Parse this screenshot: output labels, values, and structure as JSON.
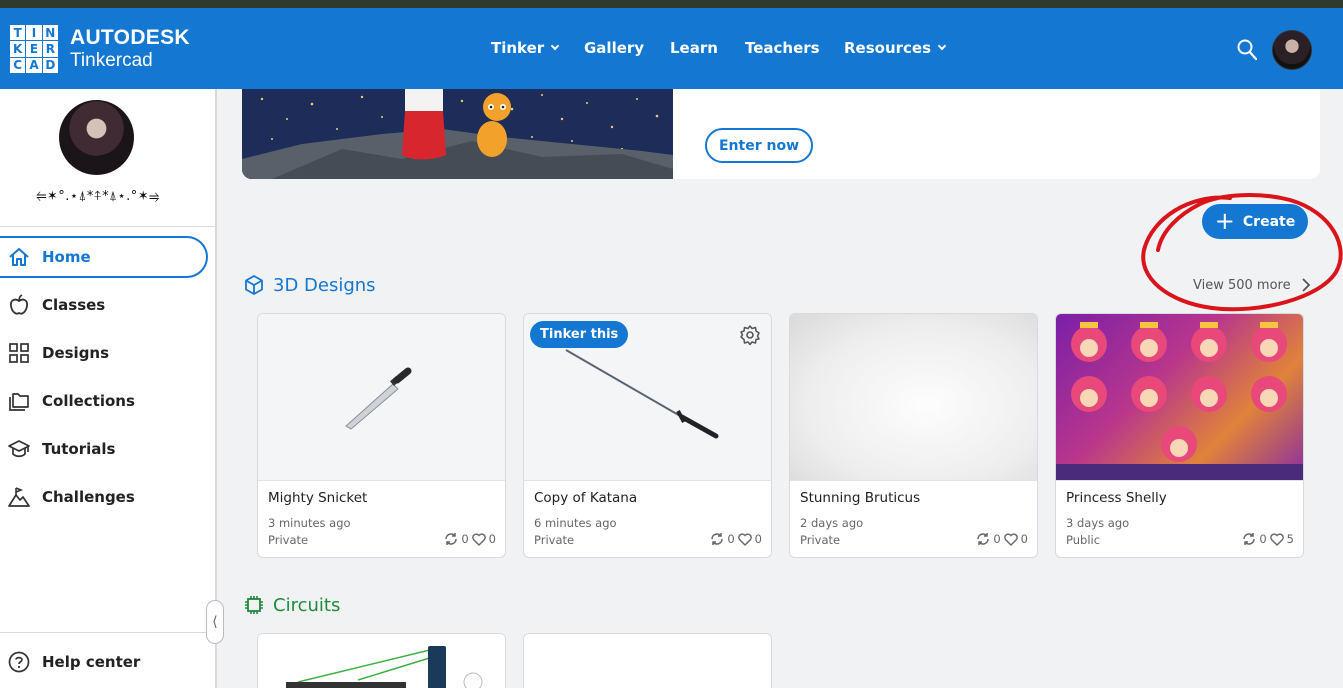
{
  "header": {
    "logo_letters": [
      "T",
      "I",
      "N",
      "K",
      "E",
      "R",
      "C",
      "A",
      "D"
    ],
    "brand_line1": "AUTODESK",
    "brand_line2": "Tinkercad",
    "nav": [
      {
        "label": "Tinker",
        "has_caret": true
      },
      {
        "label": "Gallery",
        "has_caret": false
      },
      {
        "label": "Learn",
        "has_caret": false
      },
      {
        "label": "Teachers",
        "has_caret": false
      },
      {
        "label": "Resources",
        "has_caret": true
      }
    ]
  },
  "sidebar": {
    "username": "⥢✶°.⋆⍋*⍏*⍋⋆.°✶⥤",
    "items": [
      {
        "label": "Home",
        "icon": "home-icon",
        "active": true
      },
      {
        "label": "Classes",
        "icon": "apple-icon",
        "active": false
      },
      {
        "label": "Designs",
        "icon": "grid-icon",
        "active": false
      },
      {
        "label": "Collections",
        "icon": "folders-icon",
        "active": false
      },
      {
        "label": "Tutorials",
        "icon": "graduation-cap-icon",
        "active": false
      },
      {
        "label": "Challenges",
        "icon": "mountain-flag-icon",
        "active": false
      }
    ],
    "help_label": "Help center",
    "collapse_glyph": "⟨"
  },
  "banner": {
    "enter_label": "Enter now"
  },
  "create_label": "Create",
  "designs": {
    "title": "3D Designs",
    "view_more": "View 500 more",
    "cards": [
      {
        "title": "Mighty Snicket",
        "time": "3 minutes ago",
        "privacy": "Private",
        "tinkers": "0",
        "likes": "0"
      },
      {
        "title": "Copy of Katana",
        "time": "6 minutes ago",
        "privacy": "Private",
        "tinkers": "0",
        "likes": "0",
        "badge": "Tinker this"
      },
      {
        "title": "Stunning Bruticus",
        "time": "2 days ago",
        "privacy": "Private",
        "tinkers": "0",
        "likes": "0"
      },
      {
        "title": "Princess Shelly",
        "time": "3 days ago",
        "privacy": "Public",
        "tinkers": "0",
        "likes": "5"
      }
    ]
  },
  "circuits": {
    "title": "Circuits"
  },
  "colors": {
    "brand_blue": "#1477d1",
    "circuits_green": "#1f8a3a",
    "annotation_red": "#d9141a"
  }
}
